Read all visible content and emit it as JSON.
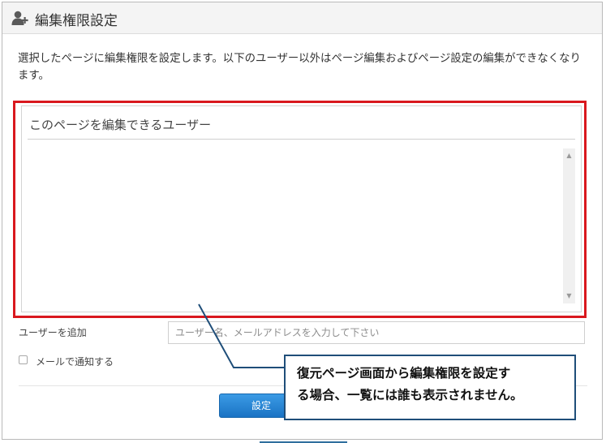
{
  "dialog": {
    "title": "編集権限設定",
    "title_icon": "user-add-icon",
    "description": "選択したページに編集権限を設定します。以下のユーザー以外はページ編集およびページ設定の編集ができなくなります。",
    "panel": {
      "header": "このページを編集できるユーザー",
      "users": []
    },
    "add_user": {
      "label": "ユーザーを追加",
      "placeholder": "ユーザー名、メールアドレスを入力して下さい",
      "value": ""
    },
    "notify": {
      "label": "メールで通知する",
      "checked": false
    },
    "submit_label": "設定"
  },
  "callout": {
    "line1": "復元ページ画面から編集権限を設定す",
    "line2": "る場合、一覧には誰も表示されません。"
  },
  "colors": {
    "highlight_border": "#d9181e",
    "callout_border": "#1f4e79",
    "button": "#1a73c4"
  }
}
